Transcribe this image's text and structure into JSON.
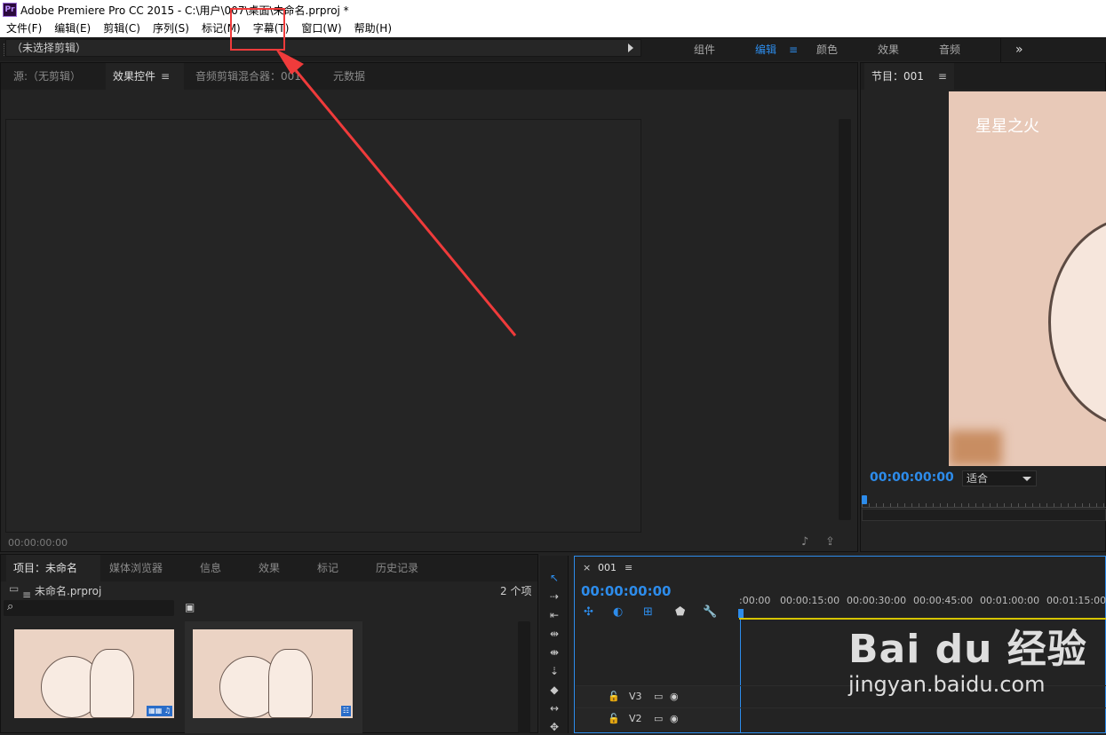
{
  "window": {
    "title": "Adobe Premiere Pro CC 2015 - C:\\用户\\007\\桌面\\未命名.prproj *",
    "logo": "Pr"
  },
  "menu": [
    "文件(F)",
    "编辑(E)",
    "剪辑(C)",
    "序列(S)",
    "标记(M)",
    "字幕(T)",
    "窗口(W)",
    "帮助(H)"
  ],
  "workspaces": {
    "items": [
      "组件",
      "编辑",
      "颜色",
      "效果",
      "音频"
    ],
    "active": "编辑",
    "more": "»",
    "menu_icon": "≡"
  },
  "source_panel": {
    "tabs": [
      "源:（无剪辑）",
      "效果控件",
      "音频剪辑混合器：001",
      "元数据"
    ],
    "active_tab": "效果控件",
    "tab_menu": "≡",
    "no_clip": "（未选择剪辑）",
    "timecode": "00:00:00:00"
  },
  "program_panel": {
    "title": "节目：001",
    "menu": "≡",
    "video_caption": "星星之火",
    "timecode": "00:00:00:00",
    "fit": "适合"
  },
  "project_panel": {
    "tabs": [
      "项目：未命名",
      "媒体浏览器",
      "信息",
      "效果",
      "标记",
      "历史记录"
    ],
    "menu": "≡",
    "file": "未命名.prproj",
    "item_count": "2 个项",
    "search_icon": "⌕",
    "folder_icon": "▣"
  },
  "timeline": {
    "close": "×",
    "name": "001",
    "menu": "≡",
    "timecode": "00:00:00:00",
    "ruler": [
      ":00:00",
      "00:00:15:00",
      "00:00:30:00",
      "00:00:45:00",
      "00:01:00:00",
      "00:01:15:00"
    ],
    "tracks": [
      {
        "lock": "🔓",
        "name": "V3"
      },
      {
        "lock": "🔓",
        "name": "V2"
      }
    ]
  },
  "watermark": {
    "brand": "Bai du 经验",
    "url": "jingyan.baidu.com"
  },
  "colors": {
    "accent": "#2d8ceb",
    "annotation": "#ef3b3b",
    "panel_bg": "#232323"
  }
}
